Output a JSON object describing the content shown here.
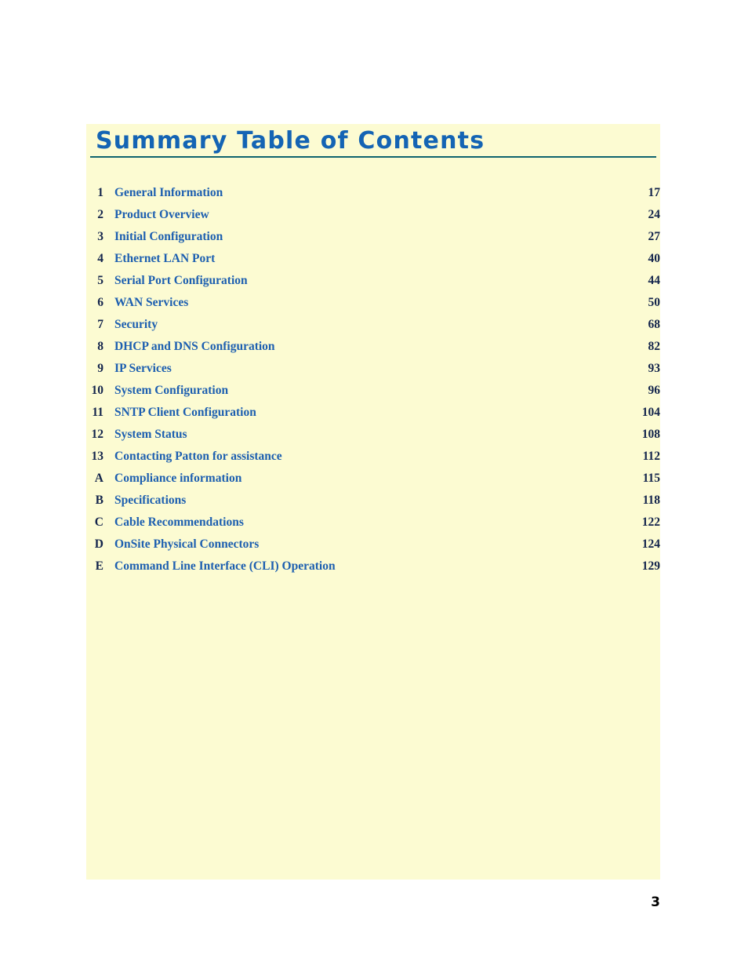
{
  "document": {
    "page_number": "3",
    "title": "Summary Table of Contents",
    "accent_color": "#1464b4",
    "panel_color": "#fcfbd2",
    "rule_color": "#10646e",
    "label_color": "#1d5fb0",
    "number_color": "#13244c"
  },
  "toc": {
    "leader_character": ".",
    "entries": [
      {
        "number": "1",
        "label": "General Information",
        "page": "17"
      },
      {
        "number": "2",
        "label": "Product Overview",
        "page": "24"
      },
      {
        "number": "3",
        "label": "Initial Configuration",
        "page": "27"
      },
      {
        "number": "4",
        "label": "Ethernet LAN Port",
        "page": "40"
      },
      {
        "number": "5",
        "label": "Serial Port Configuration",
        "page": "44"
      },
      {
        "number": "6",
        "label": "WAN Services",
        "page": "50"
      },
      {
        "number": "7",
        "label": "Security",
        "page": "68"
      },
      {
        "number": "8",
        "label": "DHCP and DNS Configuration",
        "page": "82"
      },
      {
        "number": "9",
        "label": "IP Services",
        "page": "93"
      },
      {
        "number": "10",
        "label": "System Configuration",
        "page": "96"
      },
      {
        "number": "11",
        "label": "SNTP Client Configuration",
        "page": "104"
      },
      {
        "number": "12",
        "label": "System Status",
        "page": "108"
      },
      {
        "number": "13",
        "label": "Contacting Patton for assistance",
        "page": "112"
      },
      {
        "number": "A",
        "label": "Compliance information",
        "page": "115"
      },
      {
        "number": "B",
        "label": "Specifications",
        "page": "118"
      },
      {
        "number": "C",
        "label": "Cable Recommendations",
        "page": "122"
      },
      {
        "number": "D",
        "label": "OnSite Physical Connectors",
        "page": "124"
      },
      {
        "number": "E",
        "label": "Command Line Interface (CLI) Operation",
        "page": "129"
      }
    ]
  }
}
